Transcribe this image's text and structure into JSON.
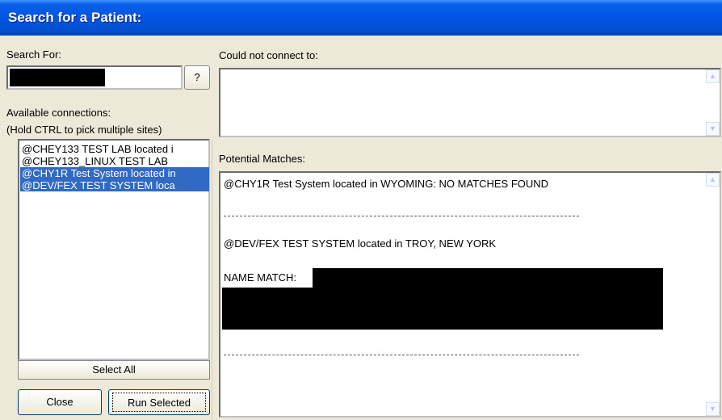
{
  "window": {
    "title": "Search for a Patient:"
  },
  "left": {
    "search_label": "Search For:",
    "help_button": "?",
    "available_label": "Available connections:",
    "hint": "(Hold CTRL to pick multiple sites)",
    "connections": [
      {
        "label": "@CHEY133 TEST LAB located i",
        "selected": false
      },
      {
        "label": "@CHEY133_LINUX TEST LAB",
        "selected": false
      },
      {
        "label": "@CHY1R Test System located in",
        "selected": true
      },
      {
        "label": "@DEV/FEX TEST SYSTEM loca",
        "selected": true
      }
    ],
    "select_all": "Select All",
    "close": "Close",
    "run_selected": "Run Selected"
  },
  "right": {
    "could_not_connect_label": "Could not connect to:",
    "potential_matches_label": "Potential Matches:",
    "results": {
      "line1": "@CHY1R Test System located in WYOMING: NO MATCHES FOUND",
      "line2": "@DEV/FEX TEST SYSTEM located in TROY, NEW YORK",
      "name_match": "NAME MATCH:"
    }
  },
  "colors": {
    "selection": "#316ac5",
    "title_bar": "#0054e3"
  }
}
